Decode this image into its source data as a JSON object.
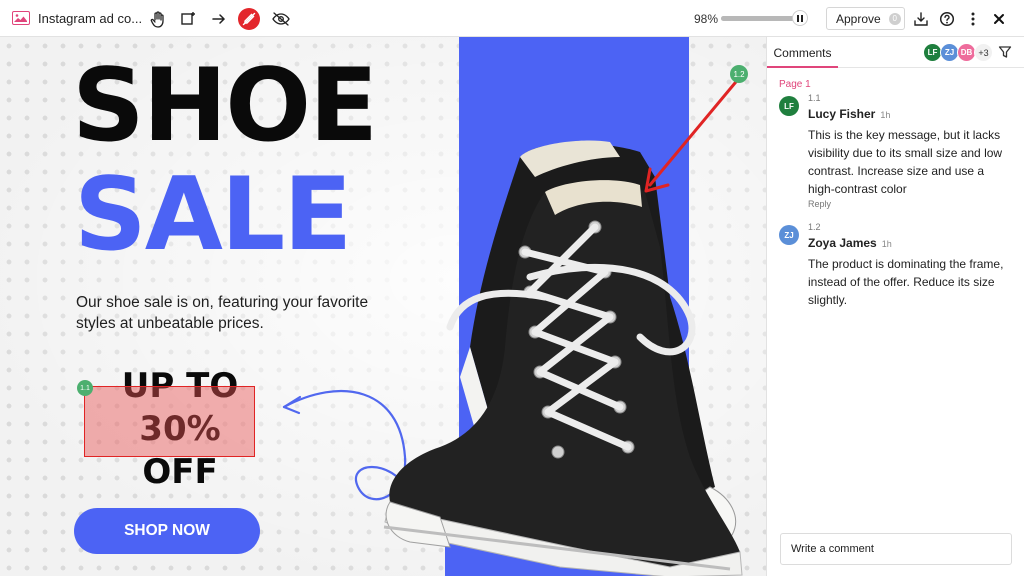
{
  "toolbar": {
    "file_title": "Instagram ad co...",
    "zoom": "98%",
    "progress_fraction": 0.98,
    "approve_label": "Approve",
    "approve_count": "0"
  },
  "canvas": {
    "headline_1": "SHOE",
    "headline_2": "SALE",
    "subtext": "Our shoe sale is on, featuring your favorite styles at unbeatable prices.",
    "offer_line_1": "UP TO",
    "offer_line_2": "30%",
    "offer_line_3": "OFF",
    "shop_button": "SHOP NOW",
    "marker_1": "1.1",
    "marker_2": "1.2"
  },
  "panel": {
    "tab_label": "Comments",
    "avatars": [
      "LF",
      "ZJ",
      "DB"
    ],
    "more_count": "+3",
    "page_label": "Page 1",
    "comments": [
      {
        "number": "1.1",
        "initials": "LF",
        "author": "Lucy Fisher",
        "time": "1h",
        "text": "This is the key message, but it lacks visibility due to its small size and low contrast. Increase size and use a high-contrast color",
        "reply_label": "Reply"
      },
      {
        "number": "1.2",
        "initials": "ZJ",
        "author": "Zoya James",
        "time": "1h",
        "text": "The product is dominating the frame, instead of the offer. Reduce its size slightly."
      }
    ],
    "comment_placeholder": "Write a comment"
  },
  "colors": {
    "brand_blue": "#4c63f4",
    "accent_pink": "#e0457b",
    "annotation_red": "#e02424",
    "marker_green": "#4caf6f"
  }
}
